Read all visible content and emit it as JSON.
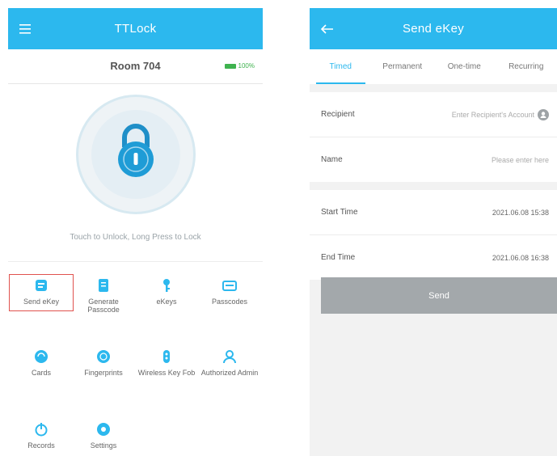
{
  "left": {
    "title": "TTLock",
    "room_name": "Room 704",
    "battery_text": "100%",
    "battery_color": "#3fb34f",
    "hint": "Touch to Unlock, Long Press to Lock",
    "grid": [
      {
        "label": "Send eKey",
        "icon": "send-ekey-icon"
      },
      {
        "label": "Generate Passcode",
        "icon": "generate-passcode-icon"
      },
      {
        "label": "eKeys",
        "icon": "ekeys-icon"
      },
      {
        "label": "Passcodes",
        "icon": "passcodes-icon"
      },
      {
        "label": "Cards",
        "icon": "cards-icon"
      },
      {
        "label": "Fingerprints",
        "icon": "fingerprint-icon"
      },
      {
        "label": "Wireless Key Fob",
        "icon": "key-fob-icon"
      },
      {
        "label": "Authorized Admin",
        "icon": "admin-icon"
      },
      {
        "label": "Records",
        "icon": "records-icon"
      },
      {
        "label": "Settings",
        "icon": "settings-icon"
      }
    ]
  },
  "right": {
    "title": "Send eKey",
    "tabs": [
      "Timed",
      "Permanent",
      "One-time",
      "Recurring"
    ],
    "recipient_label": "Recipient",
    "recipient_placeholder": "Enter Recipient's Account",
    "name_label": "Name",
    "name_placeholder": "Please enter here",
    "start_label": "Start Time",
    "start_value": "2021.06.08 15:38",
    "end_label": "End Time",
    "end_value": "2021.06.08 16:38",
    "send_label": "Send"
  },
  "colors": {
    "accent": "#2cb8ee",
    "selection_outline": "#e0524e",
    "button_disabled": "#a3a8ab"
  }
}
